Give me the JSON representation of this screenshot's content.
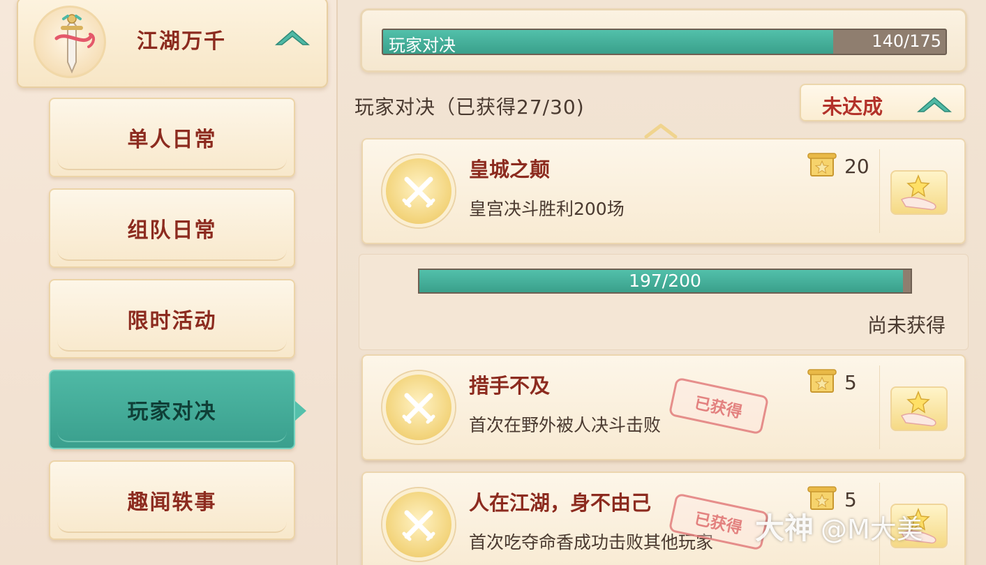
{
  "sidebar": {
    "category": {
      "title": "江湖万千"
    },
    "items": [
      {
        "label": "单人日常",
        "active": false
      },
      {
        "label": "组队日常",
        "active": false
      },
      {
        "label": "限时活动",
        "active": false
      },
      {
        "label": "玩家对决",
        "active": true
      },
      {
        "label": "趣闻轶事",
        "active": false
      }
    ]
  },
  "total_progress": {
    "label": "玩家对决",
    "count": "140/175",
    "current": 140,
    "max": 175
  },
  "section": {
    "title": "玩家对决（已获得27/30)",
    "status_button": "未达成"
  },
  "achievements": [
    {
      "name": "皇城之颠",
      "desc": "皇宫决斗胜利200场",
      "reward": "20",
      "stamp": ""
    },
    {
      "name": "措手不及",
      "desc": "首次在野外被人决斗击败",
      "reward": "5",
      "stamp": "已获得"
    },
    {
      "name": "人在江湖，身不由己",
      "desc": "首次吃夺命香成功击败其他玩家",
      "reward": "5",
      "stamp": "已获得"
    }
  ],
  "expanded": {
    "count": "197/200",
    "current": 197,
    "max": 200,
    "status": "尚未获得"
  },
  "watermark": {
    "brand": "大神",
    "handle": "@M大美"
  },
  "colors": {
    "accent": "#3fa893",
    "title_red": "#8c2b1f",
    "status_red": "#b3322a"
  },
  "icons": {
    "category": "sword-emblem-icon",
    "achievement": "crossed-swords-icon",
    "reward": "scroll-token-icon",
    "claim": "star-hand-icon"
  }
}
